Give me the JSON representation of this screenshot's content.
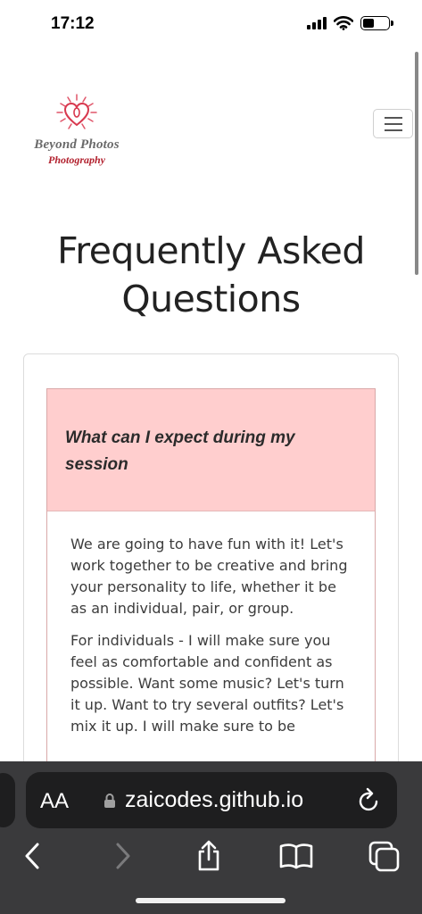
{
  "status_bar": {
    "time": "17:12",
    "icons": [
      "signal-icon",
      "wifi-icon",
      "battery-icon"
    ],
    "battery_level": 0.45
  },
  "header": {
    "logo": {
      "line1": "Beyond Photos",
      "line2": "Photography"
    },
    "menu_icon": "hamburger-icon"
  },
  "page": {
    "title_line1": "Frequently Asked",
    "title_line2": "Questions"
  },
  "faq": {
    "items": [
      {
        "question": "What can I expect during my session",
        "paragraphs": [
          "We are going to have fun with it! Let's work together to be creative and bring your personality to life, whether it be as an individual, pair, or group.",
          "For individuals - I will make sure you feel as comfortable and confident as possible. Want some music? Let's turn it up. Want to try several outfits? Let's mix it up. I will make sure to be"
        ]
      }
    ]
  },
  "browser": {
    "text_size_label": "AA",
    "url": "zaicodes.github.io",
    "toolbar_icons": [
      "back-icon",
      "forward-icon",
      "share-icon",
      "bookmarks-icon",
      "tabs-icon"
    ]
  },
  "colors": {
    "faq_header_bg": "#ffcece",
    "logo_red": "#b2212e",
    "browser_bg": "#3a3a3c"
  }
}
